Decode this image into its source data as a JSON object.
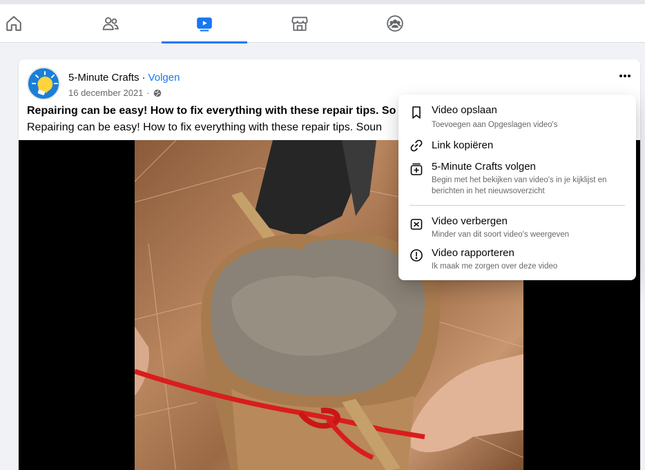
{
  "nav": {
    "tabs": [
      {
        "name": "home",
        "icon": "home-icon",
        "active": false
      },
      {
        "name": "friends",
        "icon": "friends-icon",
        "active": false
      },
      {
        "name": "watch",
        "icon": "video-play-icon",
        "active": true
      },
      {
        "name": "marketplace",
        "icon": "marketplace-icon",
        "active": false
      },
      {
        "name": "groups",
        "icon": "groups-icon",
        "active": false
      }
    ],
    "accent_color": "#1877f2"
  },
  "post": {
    "author": "5-Minute Crafts",
    "separator": "·",
    "follow_label": "Volgen",
    "date": "16 december 2021",
    "title": "Repairing can be easy! How to fix everything with these repair tips. So",
    "text": "Repairing can be easy! How to fix everything with these repair tips. Soun"
  },
  "menu": {
    "items": [
      {
        "label": "Video opslaan",
        "sub": "Toevoegen aan Opgeslagen video's",
        "icon": "bookmark-icon"
      },
      {
        "label": "Link kopiëren",
        "sub": "",
        "icon": "link-icon"
      },
      {
        "label": "5-Minute Crafts volgen",
        "sub": "Begin met het bekijken van video's in je kijklijst en berichten in het nieuwsoverzicht",
        "icon": "follow-icon"
      },
      {
        "label": "Video verbergen",
        "sub": "Minder van dit soort video's weergeven",
        "icon": "hide-icon"
      },
      {
        "label": "Video rapporteren",
        "sub": "Ik maak me zorgen over deze video",
        "icon": "report-icon"
      }
    ]
  }
}
